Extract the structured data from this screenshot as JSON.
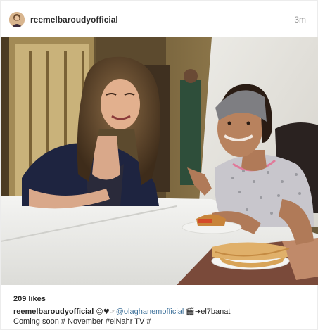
{
  "post": {
    "username": "reemelbaroudyofficial",
    "time": "3m",
    "likes": "209 likes",
    "caption": {
      "username": "reemelbaroudyofficial",
      "emojis_1": "☺♥☞",
      "mention": "@olaghanemofficial",
      "emojis_2": "🎬➜",
      "tag_text": "el7banat",
      "line2": "Coming soon # November #elNahr TV #"
    },
    "icons": [
      "user-avatar",
      "smiling-face-icon",
      "heart-icon",
      "pointing-hand-icon",
      "clapper-board-icon",
      "arrow-icon"
    ]
  }
}
